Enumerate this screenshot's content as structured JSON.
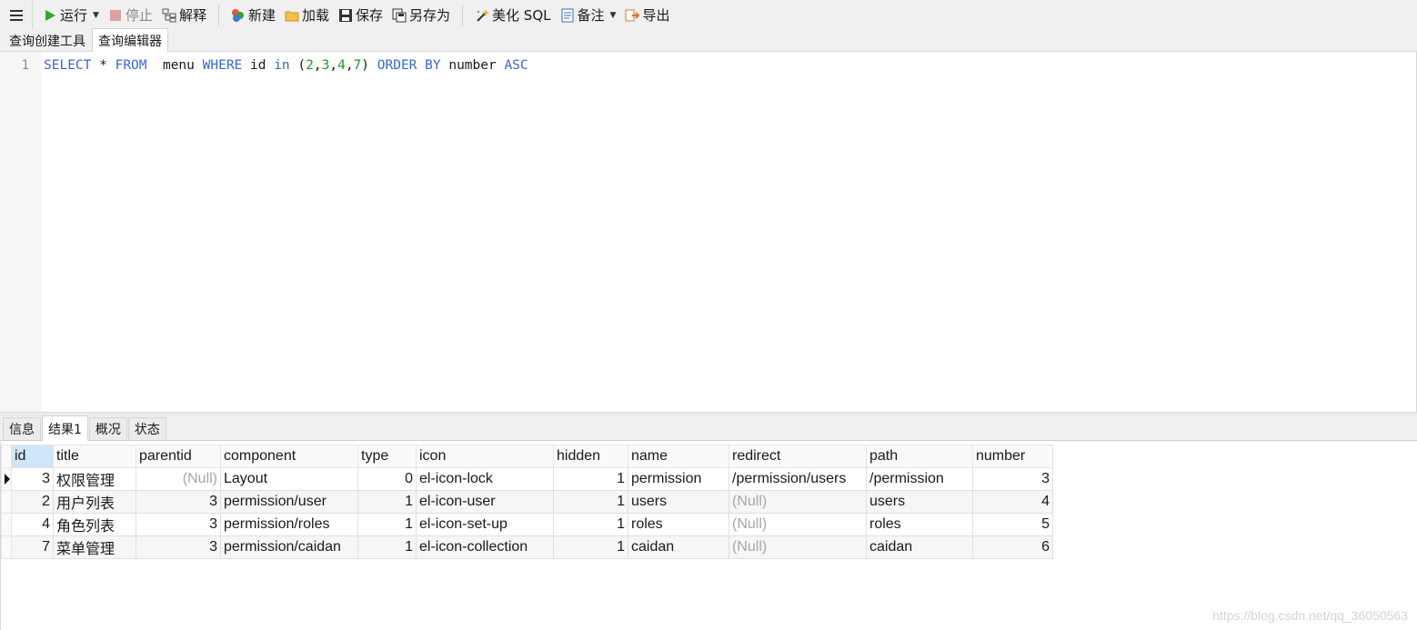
{
  "toolbar": {
    "run": "运行",
    "stop": "停止",
    "explain": "解释",
    "new": "新建",
    "load": "加载",
    "save": "保存",
    "save_as": "另存为",
    "beautify": "美化 SQL",
    "note": "备注",
    "export": "导出"
  },
  "editor_tabs": [
    "查询创建工具",
    "查询编辑器"
  ],
  "editor": {
    "line_number": "1",
    "sql": {
      "select": "SELECT",
      "star": " * ",
      "from": "FROM",
      "table": "  menu ",
      "where": "WHERE",
      "col": " id ",
      "in": "in",
      "open": " (",
      "n1": "2",
      "n2": "3",
      "n3": "4",
      "n4": "7",
      "comma": ",",
      "close": ") ",
      "order": "ORDER",
      "by": "BY",
      "ordcol": " number ",
      "asc": "ASC"
    }
  },
  "result_tabs": [
    "信息",
    "结果1",
    "概况",
    "状态"
  ],
  "grid": {
    "columns": [
      "id",
      "title",
      "parentid",
      "component",
      "type",
      "icon",
      "hidden",
      "name",
      "redirect",
      "path",
      "number"
    ],
    "rows": [
      [
        "3",
        "权限管理",
        "(Null)",
        "Layout",
        "0",
        "el-icon-lock",
        "1",
        "permission",
        "/permission/users",
        "/permission",
        "3"
      ],
      [
        "2",
        "用户列表",
        "3",
        "permission/user",
        "1",
        "el-icon-user",
        "1",
        "users",
        "(Null)",
        "users",
        "4"
      ],
      [
        "4",
        "角色列表",
        "3",
        "permission/roles",
        "1",
        "el-icon-set-up",
        "1",
        "roles",
        "(Null)",
        "roles",
        "5"
      ],
      [
        "7",
        "菜单管理",
        "3",
        "permission/caidan",
        "1",
        "el-icon-collection",
        "1",
        "caidan",
        "(Null)",
        "caidan",
        "6"
      ]
    ]
  },
  "watermark": "https://blog.csdn.net/qq_36050563",
  "colors": {
    "keyword": "#3a66d8",
    "number": "#229922",
    "null": "#a8a8a8",
    "header_selected": "#cfe5f8"
  }
}
